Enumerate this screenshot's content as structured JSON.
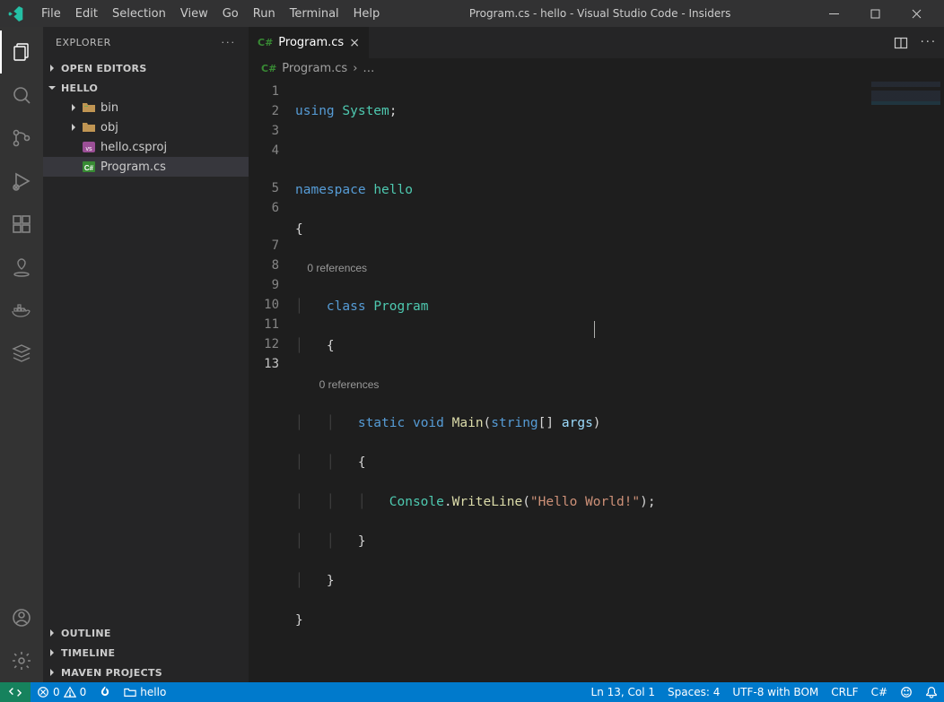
{
  "window": {
    "title": "Program.cs - hello - Visual Studio Code - Insiders"
  },
  "menu": [
    "File",
    "Edit",
    "Selection",
    "View",
    "Go",
    "Run",
    "Terminal",
    "Help"
  ],
  "sidebar": {
    "title": "EXPLORER",
    "sections": {
      "open_editors": "OPEN EDITORS",
      "workspace": "HELLO",
      "outline": "OUTLINE",
      "timeline": "TIMELINE",
      "maven": "MAVEN PROJECTS"
    },
    "tree": {
      "items": [
        {
          "label": "bin",
          "kind": "folder"
        },
        {
          "label": "obj",
          "kind": "folder"
        },
        {
          "label": "hello.csproj",
          "kind": "csproj"
        },
        {
          "label": "Program.cs",
          "kind": "cs",
          "selected": true
        }
      ]
    }
  },
  "tabs": {
    "active": {
      "label": "Program.cs",
      "lang_badge": "C#"
    }
  },
  "breadcrumb": {
    "file_badge": "C#",
    "file": "Program.cs",
    "sep": "›",
    "more": "…"
  },
  "codelens": {
    "class": "0 references",
    "main": "0 references"
  },
  "code": {
    "l1": {
      "using": "using",
      "system": "System",
      "semi": ";"
    },
    "l3": {
      "ns": "namespace",
      "name": "hello"
    },
    "l4": "{",
    "class": {
      "kw": "class",
      "name": "Program"
    },
    "class_open": "{",
    "main": {
      "static": "static",
      "void": "void",
      "name": "Main",
      "open": "(",
      "type": "string",
      "brackets": "[]",
      "arg": "args",
      "close": ")"
    },
    "main_open": "{",
    "call": {
      "console": "Console",
      "dot": ".",
      "write": "WriteLine",
      "open": "(",
      "str": "\"Hello World!\"",
      "close": ")",
      "semi": ";"
    },
    "main_close": "}",
    "class_close": "}",
    "ns_close": "}"
  },
  "line_numbers": [
    "1",
    "2",
    "3",
    "4",
    "5",
    "6",
    "7",
    "8",
    "9",
    "10",
    "11",
    "12",
    "13"
  ],
  "status": {
    "errors": "0",
    "warnings": "0",
    "folder": "hello",
    "ln_col": "Ln 13, Col 1",
    "spaces": "Spaces: 4",
    "encoding": "UTF-8 with BOM",
    "eol": "CRLF",
    "lang": "C#"
  }
}
